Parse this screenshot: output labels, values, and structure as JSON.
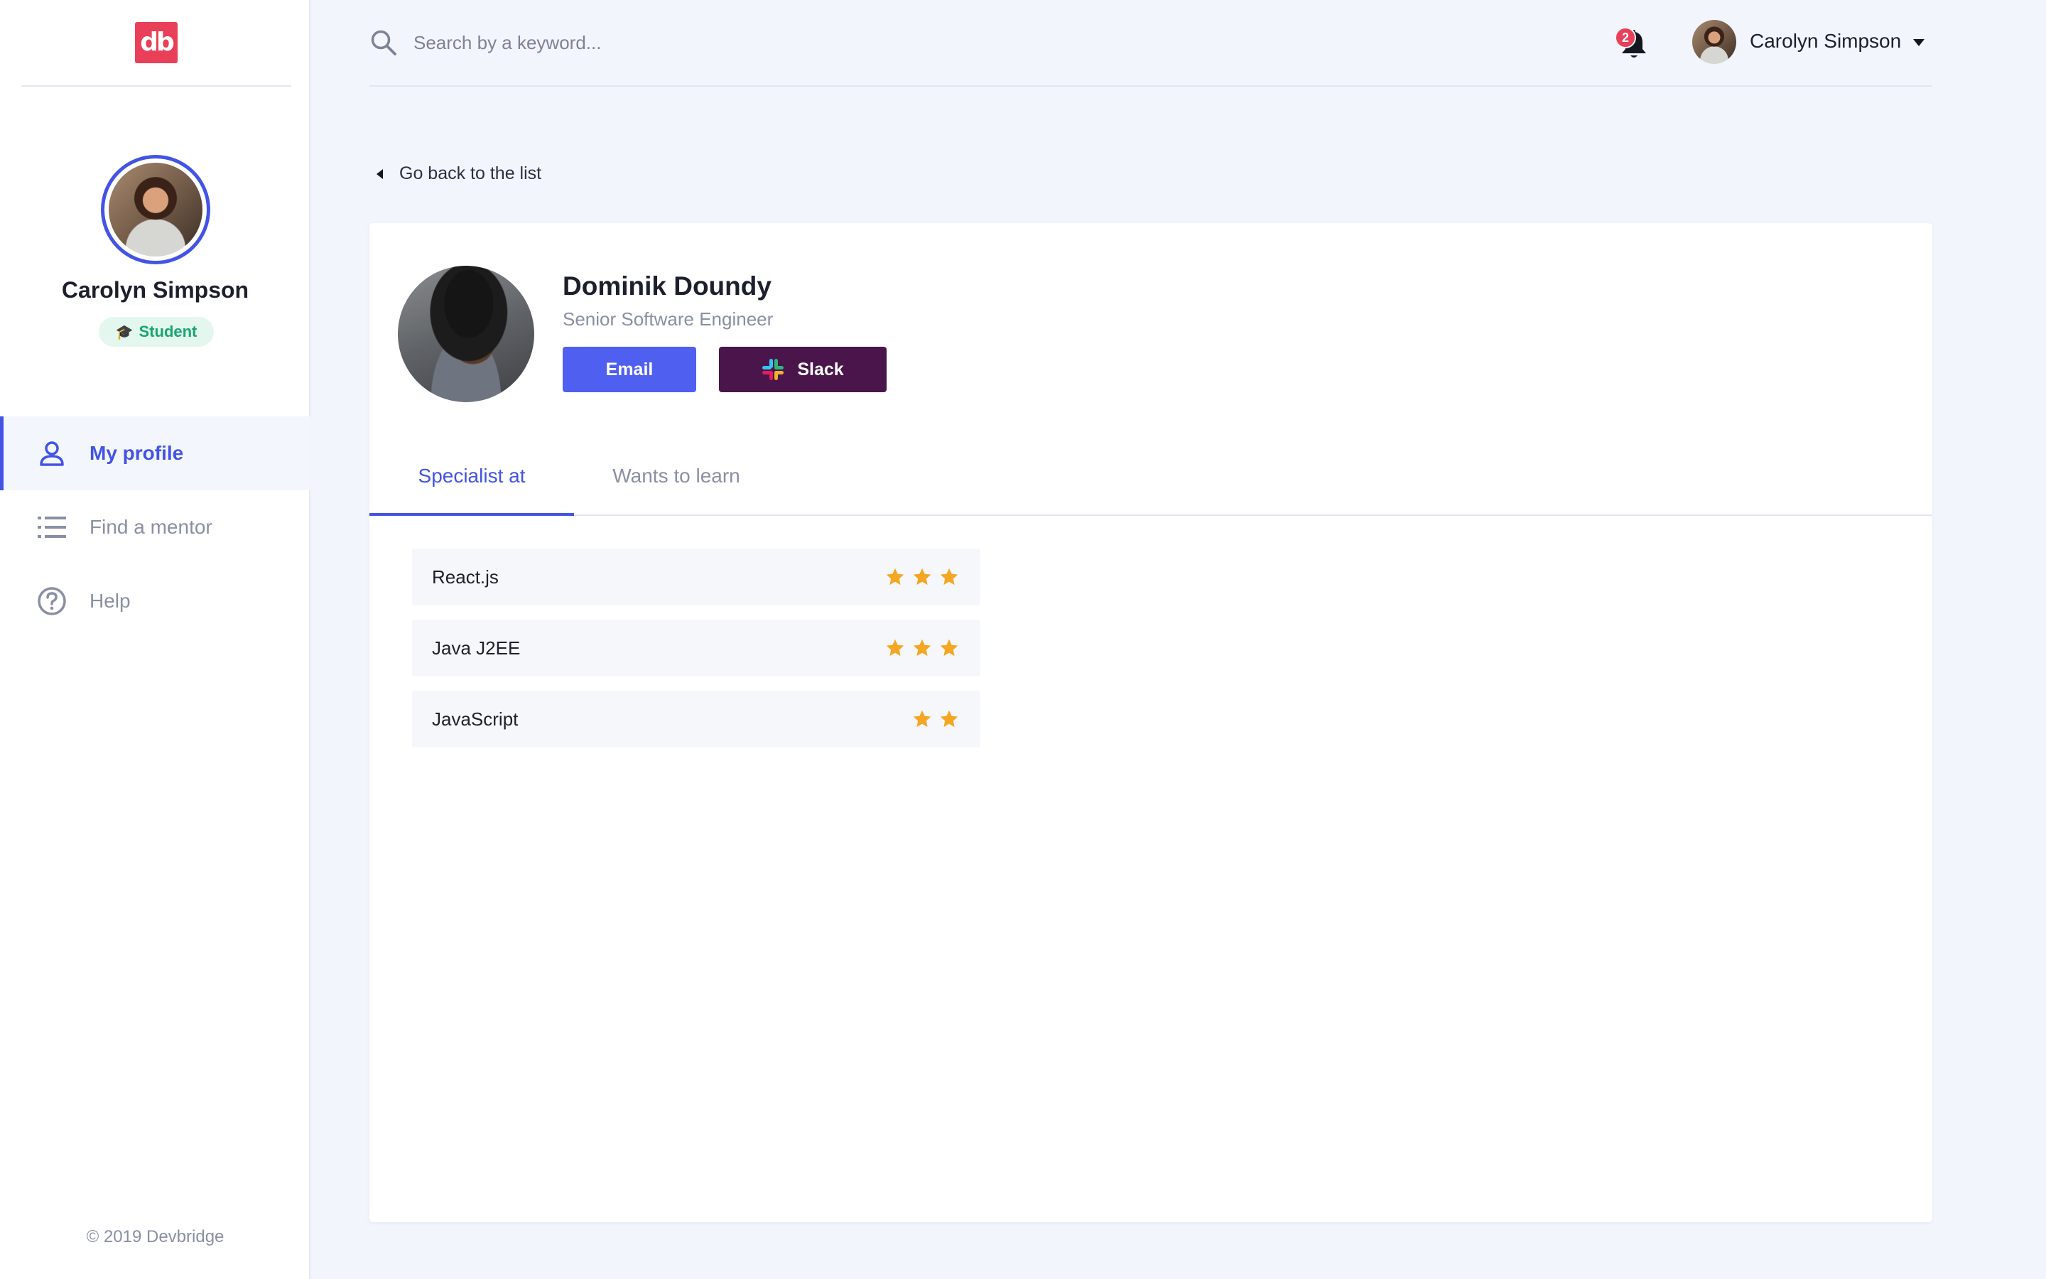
{
  "brand": {
    "logo_text": "db",
    "color": "#ea3f58"
  },
  "accent_color": "#4353e6",
  "sidebar": {
    "user_name": "Carolyn Simpson",
    "role_badge": "Student",
    "items": [
      {
        "label": "My profile",
        "icon": "person-icon",
        "active": true
      },
      {
        "label": "Find a mentor",
        "icon": "list-icon",
        "active": false
      },
      {
        "label": "Help",
        "icon": "question-circle-icon",
        "active": false
      }
    ],
    "copyright": "© 2019 Devbridge"
  },
  "header": {
    "search_placeholder": "Search by a keyword...",
    "notification_count": "2",
    "user_name": "Carolyn Simpson"
  },
  "back_link": "Go back to the list",
  "mentor": {
    "name": "Dominik Doundy",
    "title": "Senior Software Engineer",
    "email_label": "Email",
    "slack_label": "Slack"
  },
  "tabs": [
    {
      "label": "Specialist at",
      "active": true
    },
    {
      "label": "Wants to learn",
      "active": false
    }
  ],
  "skills": [
    {
      "name": "React.js",
      "stars": 3
    },
    {
      "name": "Java J2EE",
      "stars": 3
    },
    {
      "name": "JavaScript",
      "stars": 2
    }
  ]
}
